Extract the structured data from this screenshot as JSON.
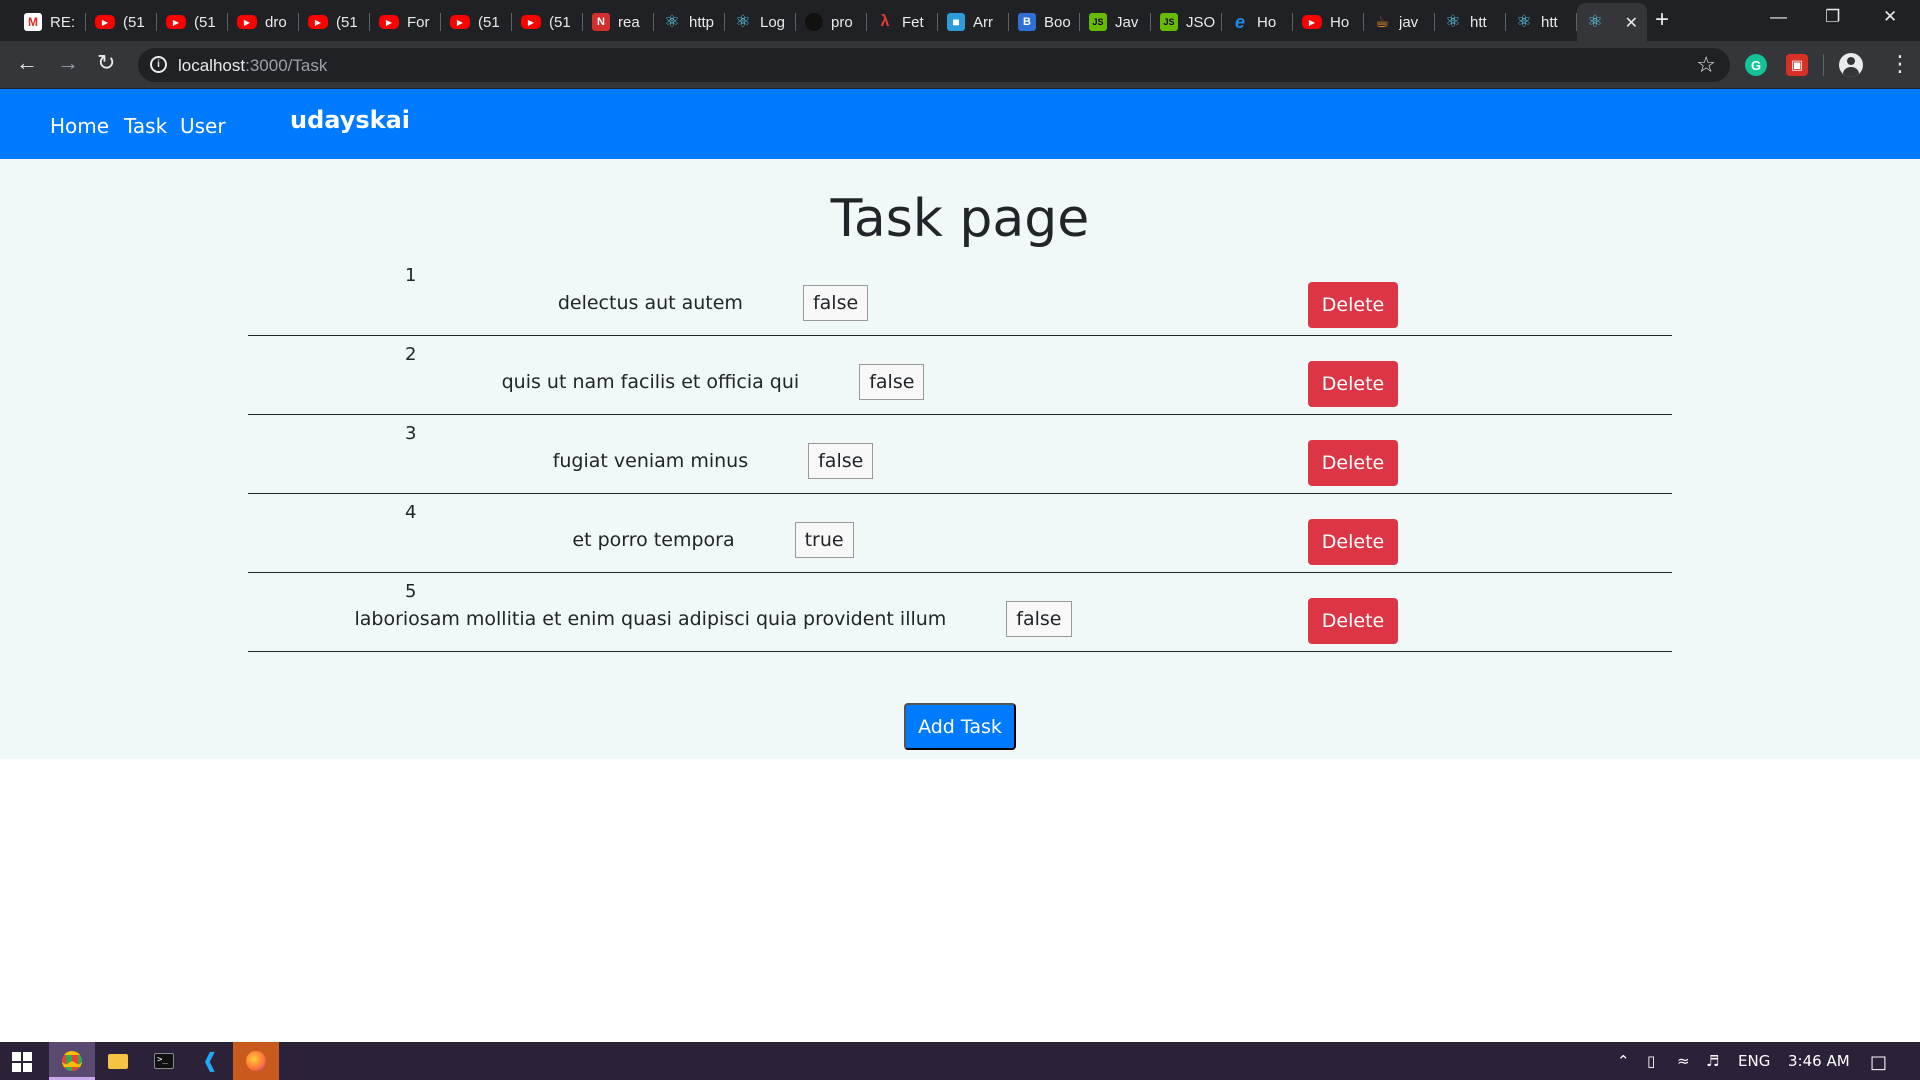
{
  "browser": {
    "tabs": [
      {
        "label": "RE:",
        "icon": "gmail-icon"
      },
      {
        "label": "(51",
        "icon": "youtube-icon"
      },
      {
        "label": "(51",
        "icon": "youtube-icon"
      },
      {
        "label": "dro",
        "icon": "youtube-icon"
      },
      {
        "label": "(51",
        "icon": "youtube-icon"
      },
      {
        "label": "For",
        "icon": "youtube-icon"
      },
      {
        "label": "(51",
        "icon": "youtube-icon"
      },
      {
        "label": "(51",
        "icon": "youtube-icon"
      },
      {
        "label": "rea",
        "icon": "red-bookmark-icon"
      },
      {
        "label": "http",
        "icon": "react-icon"
      },
      {
        "label": "Log",
        "icon": "react-icon"
      },
      {
        "label": "pro",
        "icon": "github-icon"
      },
      {
        "label": "Fet",
        "icon": "fetch-icon"
      },
      {
        "label": "Arr",
        "icon": "page-icon"
      },
      {
        "label": "Boo",
        "icon": "bootstrap-icon"
      },
      {
        "label": "Jav",
        "icon": "js-icon"
      },
      {
        "label": "JSO",
        "icon": "js-icon"
      },
      {
        "label": "Ho",
        "icon": "edge-icon"
      },
      {
        "label": "Ho",
        "icon": "youtube-icon"
      },
      {
        "label": "jav",
        "icon": "java-icon"
      },
      {
        "label": "htt",
        "icon": "react-icon"
      },
      {
        "label": "htt",
        "icon": "react-icon"
      },
      {
        "label": "",
        "icon": "react-icon",
        "active": true
      }
    ],
    "new_tab": "+",
    "url_host": "localhost",
    "url_path": ":3000/Task"
  },
  "app": {
    "nav_links": [
      "Home",
      "Task",
      "User"
    ],
    "brand": "udayskai",
    "title": "Task page",
    "tasks": [
      {
        "id": "1",
        "title": "delectus aut autem",
        "completed": "false"
      },
      {
        "id": "2",
        "title": "quis ut nam facilis et officia qui",
        "completed": "false"
      },
      {
        "id": "3",
        "title": "fugiat veniam minus",
        "completed": "false"
      },
      {
        "id": "4",
        "title": "et porro tempora",
        "completed": "true"
      },
      {
        "id": "5",
        "title": "laboriosam mollitia et enim quasi adipisci quia provident illum",
        "completed": "false"
      }
    ],
    "delete_label": "Delete",
    "add_label": "Add Task",
    "colors": {
      "primary": "#007bff",
      "danger": "#dc3545",
      "content_bg": "#f0f8f8"
    }
  },
  "taskbar": {
    "lang": "ENG",
    "time": "3:46 AM"
  }
}
